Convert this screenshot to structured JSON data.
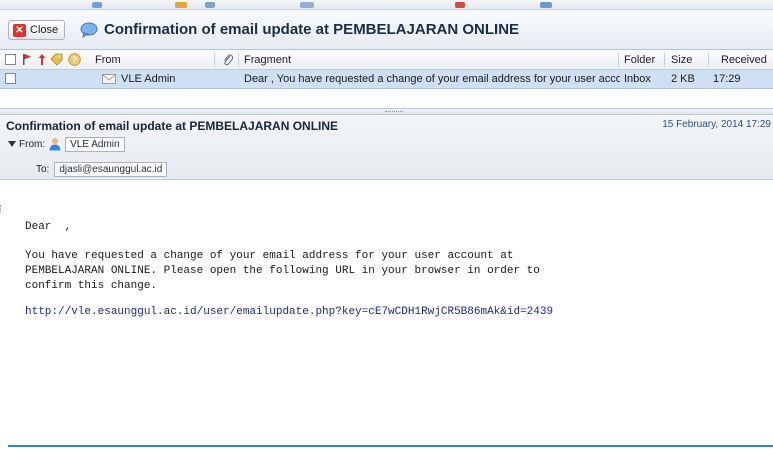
{
  "window": {
    "close_label": "Close",
    "title": "Confirmation of email update at PEMBELAJARAN ONLINE"
  },
  "list": {
    "columns": {
      "from": "From",
      "fragment": "Fragment",
      "folder": "Folder",
      "size": "Size",
      "received": "Received"
    },
    "rows": [
      {
        "from": "VLE Admin",
        "fragment": "Dear , You have requested a change of your email address for your user account at PEMBELAJARAN ONLINE",
        "folder": "Inbox",
        "size": "2 KB",
        "received": "17:29"
      }
    ]
  },
  "message": {
    "subject": "Confirmation of email update at PEMBELAJARAN ONLINE",
    "date": "15 February, 2014 17:29",
    "from_label": "From:",
    "from_name": "VLE Admin",
    "to_label": "To:",
    "to_address": "djasli@esaunggul.ac.id",
    "greeting": "Dear  ,",
    "paragraph": "You have requested a change of your email address for your user account at\nPEMBELAJARAN ONLINE. Please open the following URL in your browser in order to\nconfirm this change.",
    "link": "http://vle.esaunggul.ac.id/user/emailupdate.php?key=cE7wCDH1RwjCR5B86mAk&id=2439"
  },
  "colors": {
    "selected_row": "#cfe0f4",
    "link": "#1c2b8c",
    "date": "#2a4f8f",
    "close_icon": "#d9352c",
    "accent_line": "#3d7fd0"
  },
  "icons": {
    "close": "close-x-icon",
    "title": "speech-bubble-icon",
    "flag": "red-flag-icon",
    "priority": "priority-arrow-icon",
    "tag": "tag-icon",
    "help": "help-circle-icon",
    "attachment": "paperclip-icon",
    "envelope": "envelope-icon",
    "person": "person-icon",
    "toggle": "triangle-down-icon"
  }
}
